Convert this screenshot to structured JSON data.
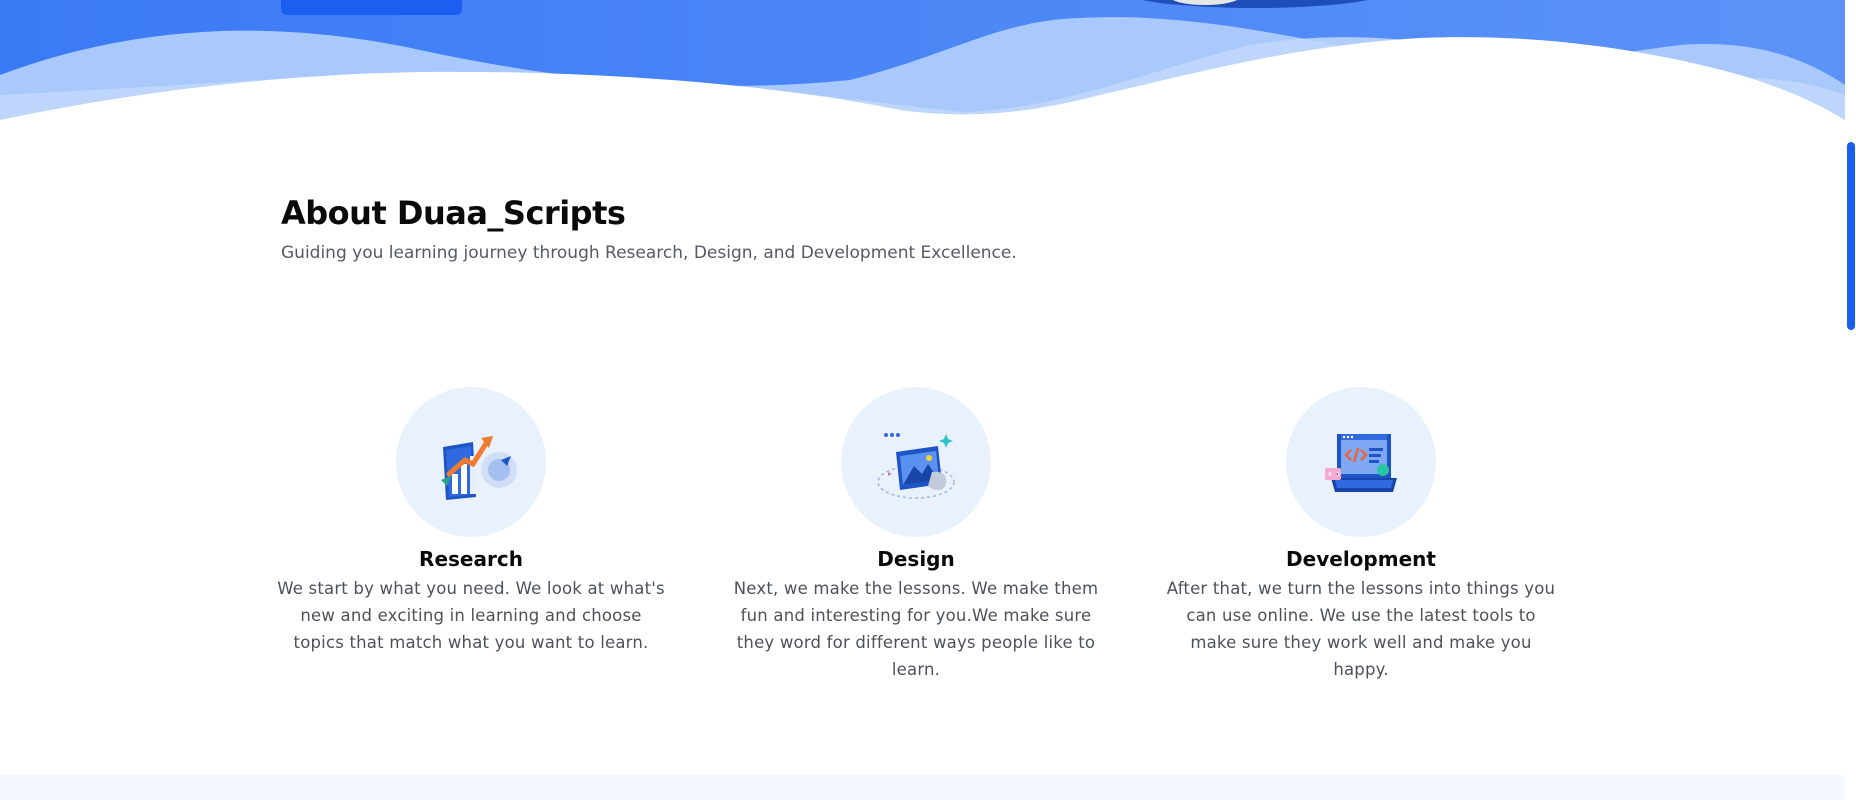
{
  "hero": {
    "gradient_start": "#3a7af5",
    "gradient_end": "#5d93f8",
    "button_color": "#1a5ff0",
    "wave_light": "#a9c8fb",
    "wave_lighter": "#c2d8fc"
  },
  "about": {
    "title": "About Duaa_Scripts",
    "subtitle": "Guiding you learning journey through Research, Design, and Development Excellence."
  },
  "features": [
    {
      "icon": "research-chart-icon",
      "title": "Research",
      "text": "We start by what you need. We look at what's new and exciting in learning and choose topics that match what you want to learn."
    },
    {
      "icon": "design-image-icon",
      "title": "Design",
      "text": "Next, we make the lessons. We make them fun and interesting for you.We make sure they word for different ways people like to learn."
    },
    {
      "icon": "development-laptop-icon",
      "title": "Development",
      "text": "After that, we turn the lessons into things you can use online. We use the latest tools to make sure they work well and make you happy."
    }
  ],
  "colors": {
    "accent": "#1a5ff0",
    "icon_circle_bg": "#e9f1fd",
    "heading": "#0a0a0a",
    "body_text": "#4d525a",
    "bottom_band": "#f5f9ff"
  }
}
